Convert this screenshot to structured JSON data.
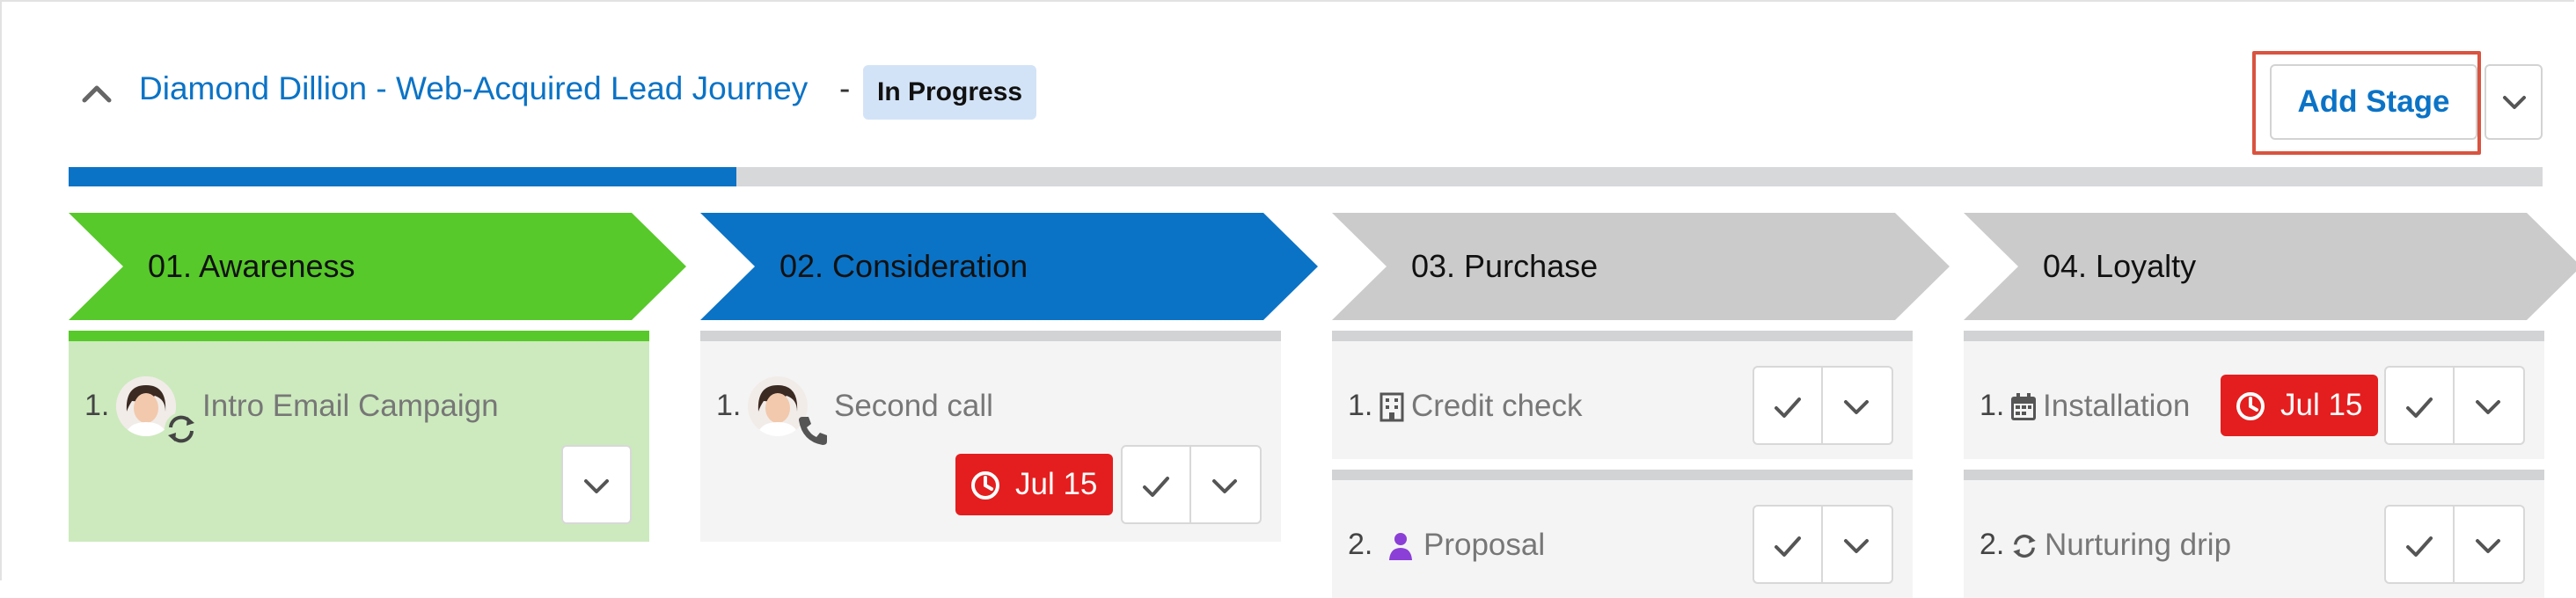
{
  "journey": {
    "contact": "Diamond Dillion",
    "separator_1": "-",
    "name": "Web-Acquired Lead Journey",
    "link_text": "Diamond Dillion - Web-Acquired Lead Journey",
    "separator_2": "-",
    "status": "In Progress",
    "progress_fraction": 0.27
  },
  "actions": {
    "add_stage_label": "Add Stage",
    "menu_icon": "chevron-down-icon",
    "collapse_icon": "chevron-up-icon"
  },
  "colors": {
    "accent": "#0b73c6",
    "completed": "#57c92a",
    "in_progress": "#0b73c6",
    "pending": "#cbcbcb",
    "due_badge": "#e41e1e",
    "highlight": "#d9533f"
  },
  "stages": [
    {
      "label": "01. Awareness",
      "state": "completed",
      "tasks": [
        {
          "number": "1.",
          "label": "Intro Email Campaign",
          "icon": "user-avatar-with-sync-icon"
        }
      ]
    },
    {
      "label": "02. Consideration",
      "state": "in_progress",
      "tasks": [
        {
          "number": "1.",
          "label": "Second call",
          "icon": "user-avatar-with-phone-icon",
          "due": "Jul 15"
        }
      ]
    },
    {
      "label": "03. Purchase",
      "state": "pending",
      "tasks": [
        {
          "number": "1.",
          "label": "Credit check",
          "icon": "building-icon"
        },
        {
          "number": "2.",
          "label": "Proposal",
          "icon": "person-icon"
        }
      ]
    },
    {
      "label": "04. Loyalty",
      "state": "pending",
      "tasks": [
        {
          "number": "1.",
          "label": "Installation",
          "icon": "calendar-icon",
          "due": "Jul 15"
        },
        {
          "number": "2.",
          "label": "Nurturing drip",
          "icon": "sync-icon"
        }
      ]
    }
  ]
}
